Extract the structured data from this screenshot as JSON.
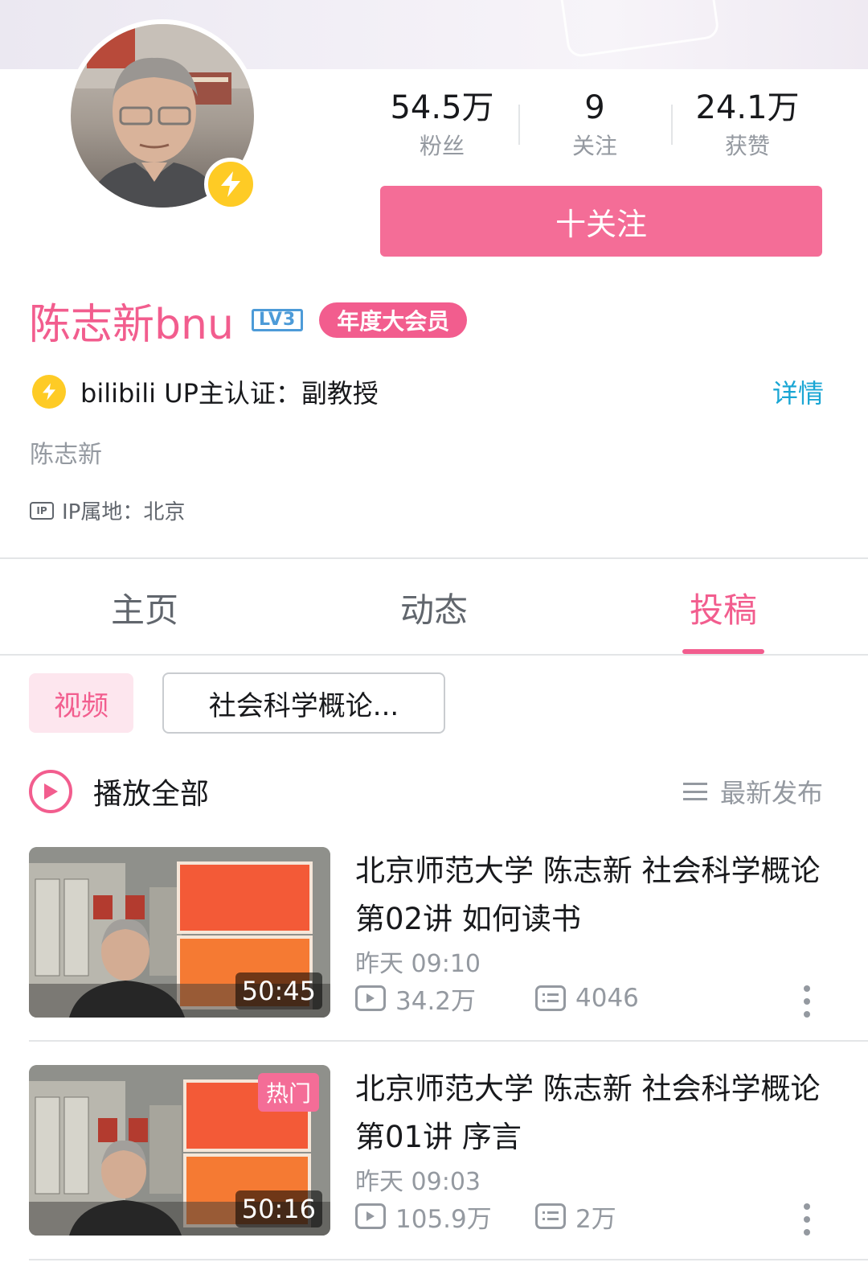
{
  "profile": {
    "name": "陈志新bnu",
    "level": "LV3",
    "vip_label": "年度大会员",
    "verify_text": "bilibili UP主认证：副教授",
    "verify_link": "详情",
    "signature": "陈志新",
    "ip_icon": "IP",
    "ip_text": "IP属地：北京",
    "avatar_badge_icon": "lightning-bolt-icon"
  },
  "stats": [
    {
      "value": "54.5万",
      "label": "粉丝"
    },
    {
      "value": "9",
      "label": "关注"
    },
    {
      "value": "24.1万",
      "label": "获赞"
    }
  ],
  "follow_button": "十关注",
  "tabs": [
    {
      "label": "主页",
      "active": false
    },
    {
      "label": "动态",
      "active": false
    },
    {
      "label": "投稿",
      "active": true
    }
  ],
  "filters": {
    "video_chip": "视频",
    "series_chip": "社会科学概论..."
  },
  "play_all": {
    "label": "播放全部",
    "sort_label": "最新发布"
  },
  "videos": [
    {
      "title": "北京师范大学 陈志新 社会科学概论  第02讲 如何读书",
      "date": "昨天 09:10",
      "plays": "34.2万",
      "danmaku": "4046",
      "duration": "50:45",
      "hot": ""
    },
    {
      "title": "北京师范大学 陈志新 社会科学概论 第01讲 序言",
      "date": "昨天 09:03",
      "plays": "105.9万",
      "danmaku": "2万",
      "duration": "50:16",
      "hot": "热门"
    }
  ],
  "colors": {
    "accent": "#f25d8e",
    "follow_button": "#f46d97",
    "link": "#1aa6d4",
    "badge_yellow": "#fecb25",
    "muted": "#9499a0"
  }
}
